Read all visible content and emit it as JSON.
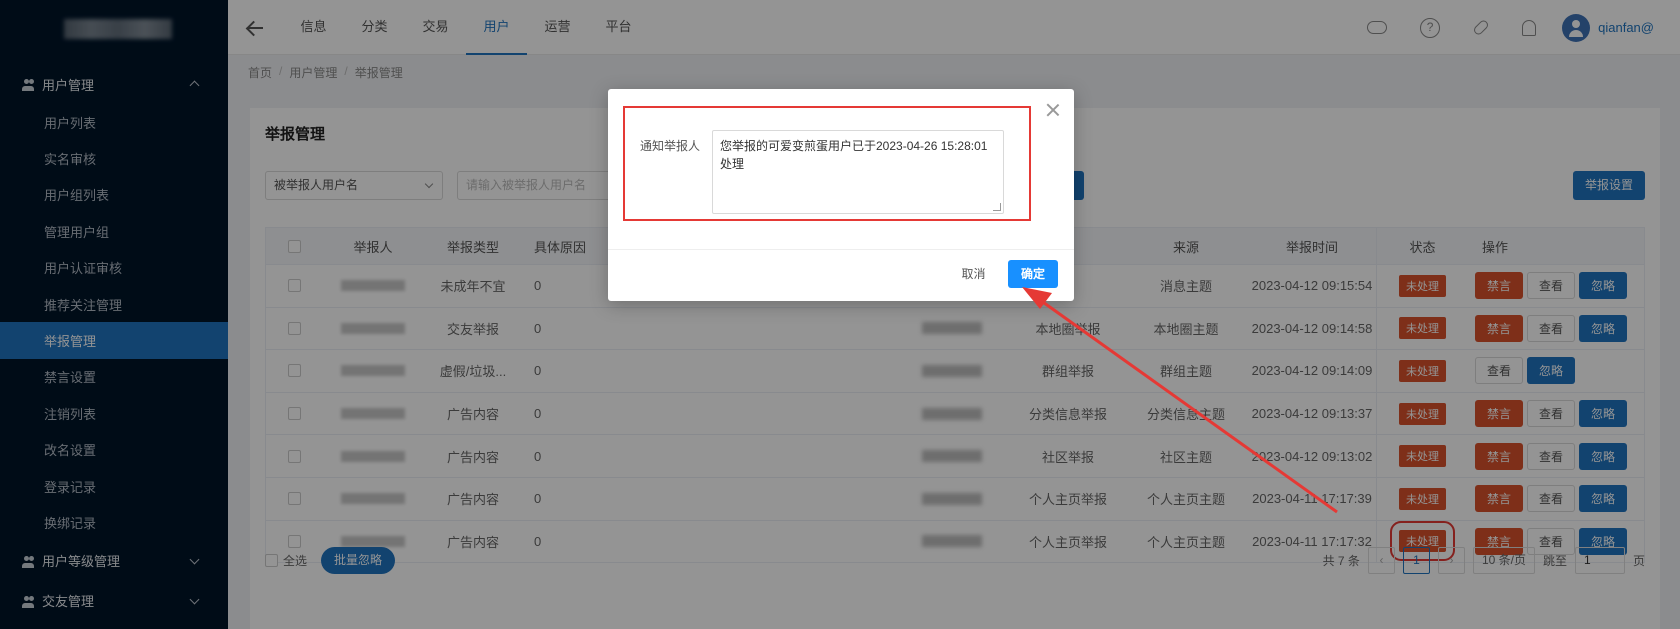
{
  "sidebar": {
    "groups": [
      {
        "label": "用户管理",
        "expanded": true
      },
      {
        "label": "用户等级管理",
        "expanded": false
      },
      {
        "label": "交友管理",
        "expanded": false
      }
    ],
    "items": [
      {
        "label": "用户列表"
      },
      {
        "label": "实名审核"
      },
      {
        "label": "用户组列表"
      },
      {
        "label": "管理用户组"
      },
      {
        "label": "用户认证审核"
      },
      {
        "label": "推荐关注管理"
      },
      {
        "label": "举报管理",
        "active": true
      },
      {
        "label": "禁言设置"
      },
      {
        "label": "注销列表"
      },
      {
        "label": "改名设置"
      },
      {
        "label": "登录记录"
      },
      {
        "label": "换绑记录"
      }
    ]
  },
  "topnav": {
    "tabs": [
      "信息",
      "分类",
      "交易",
      "用户",
      "运营",
      "平台"
    ],
    "active_tab": "用户",
    "help_icon_text": "?",
    "username": "qianfan@"
  },
  "breadcrumb": [
    "首页",
    "用户管理",
    "举报管理"
  ],
  "page": {
    "title": "举报管理",
    "filter_select": "被举报人用户名",
    "search_placeholder": "请输入被举报人用户名",
    "settings_button": "举报设置"
  },
  "table": {
    "headers": [
      "举报人",
      "举报类型",
      "具体原因",
      "来源",
      "举报时间",
      "状态",
      "操作"
    ],
    "rows": [
      {
        "type": "未成年不宜",
        "reason": "0",
        "source_type": "",
        "source": "消息主题",
        "time": "2023-04-12 09:15:54",
        "status": "未处理",
        "actions": [
          "禁言",
          "查看",
          "忽略"
        ]
      },
      {
        "type": "交友举报",
        "reason": "0",
        "source_type": "本地圈举报",
        "source": "本地圈主题",
        "time": "2023-04-12 09:14:58",
        "status": "未处理",
        "actions": [
          "禁言",
          "查看",
          "忽略"
        ]
      },
      {
        "type": "虚假/垃圾...",
        "reason": "0",
        "source_type": "群组举报",
        "source": "群组主题",
        "time": "2023-04-12 09:14:09",
        "status": "未处理",
        "actions": [
          "查看",
          "忽略"
        ]
      },
      {
        "type": "广告内容",
        "reason": "0",
        "source_type": "分类信息举报",
        "source": "分类信息主题",
        "time": "2023-04-12 09:13:37",
        "status": "未处理",
        "actions": [
          "禁言",
          "查看",
          "忽略"
        ]
      },
      {
        "type": "广告内容",
        "reason": "0",
        "source_type": "社区举报",
        "source": "社区主题",
        "time": "2023-04-12 09:13:02",
        "status": "未处理",
        "actions": [
          "禁言",
          "查看",
          "忽略"
        ]
      },
      {
        "type": "广告内容",
        "reason": "0",
        "source_type": "个人主页举报",
        "source": "个人主页主题",
        "time": "2023-04-11 17:17:39",
        "status": "未处理",
        "actions": [
          "禁言",
          "查看",
          "忽略"
        ]
      },
      {
        "type": "广告内容",
        "reason": "0",
        "source_type": "个人主页举报",
        "source": "个人主页主题",
        "time": "2023-04-11 17:17:32",
        "status": "未处理",
        "actions": [
          "禁言",
          "查看",
          "忽略"
        ],
        "highlighted": true
      }
    ]
  },
  "footer": {
    "select_all": "全选",
    "bulk_ignore": "批量忽略",
    "total": "共 7 条",
    "prev": "‹",
    "next": "›",
    "current_page": "1",
    "page_size": "10 条/页",
    "goto_label": "跳至",
    "goto_value": "1",
    "page_suffix": "页"
  },
  "modal": {
    "label": "通知举报人",
    "message": "您举报的可爱变煎蛋用户已于2023-04-26 15:28:01\n处理",
    "cancel": "取消",
    "confirm": "确定"
  },
  "colors": {
    "primary": "#1f74c0",
    "danger": "#d9522c",
    "annotation": "#e53935"
  }
}
